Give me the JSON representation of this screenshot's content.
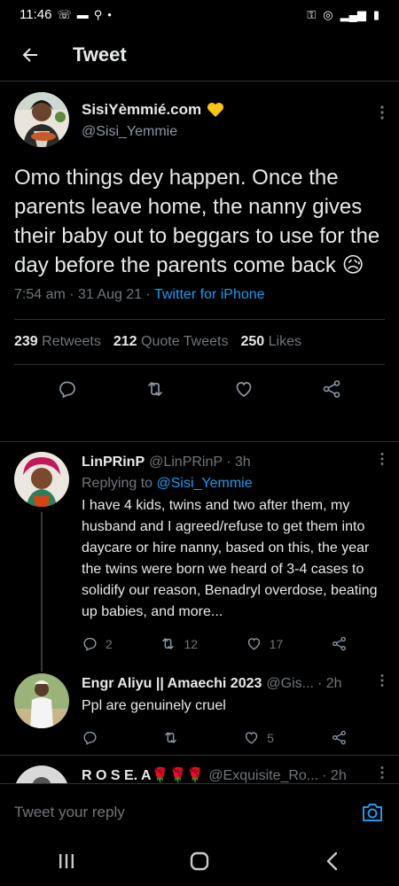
{
  "status_bar": {
    "time": "11:46",
    "left_icons": [
      "call-icon",
      "message-icon",
      "search-icon",
      "dot-icon"
    ],
    "right_icons": [
      "key-icon",
      "hotspot-icon",
      "signal-icon",
      "battery-icon"
    ]
  },
  "header": {
    "title": "Tweet"
  },
  "main_tweet": {
    "display_name": "SisiYèmmié.com",
    "handle": "@Sisi_Yemmie",
    "text": "Omo things dey happen. Once the parents leave home, the nanny gives their baby out to beggars to use for the day before the parents come back",
    "emoji": "😥",
    "time": "7:54 am · 31 Aug 21 ·",
    "source": "Twitter for iPhone",
    "stats": {
      "retweets_count": "239",
      "retweets_label": "Retweets",
      "quotes_count": "212",
      "quotes_label": "Quote Tweets",
      "likes_count": "250",
      "likes_label": "Likes"
    }
  },
  "replies": [
    {
      "name": "LinPRinP",
      "handle": "@LinPRinP",
      "time": "· 3h",
      "replying_label": "Replying to",
      "replying_handle": "@Sisi_Yemmie",
      "text": "I have 4 kids, twins and two after them,  my husband and I agreed/refuse to get them into daycare or hire nanny, based on this, the year the twins were born we heard of 3-4 cases to solidify our reason, Benadryl overdose, beating up babies, and more...",
      "reply_count": "2",
      "retweet_count": "12",
      "like_count": "17"
    },
    {
      "name": "Engr Aliyu || Amaechi 2023",
      "handle": "@Gis...",
      "time": "· 2h",
      "text": "Ppl are genuinely cruel",
      "reply_count": "",
      "retweet_count": "",
      "like_count": "5"
    },
    {
      "name": "R O S E. A🌹🌹🌹",
      "handle": "@Exquisite_Ro...",
      "time": "· 2h"
    }
  ],
  "reply_bar": {
    "placeholder": "Tweet your reply"
  },
  "colors": {
    "background": "#000000",
    "accent": "#1d9bf0",
    "muted": "#71767b",
    "divider": "#2f3336"
  }
}
